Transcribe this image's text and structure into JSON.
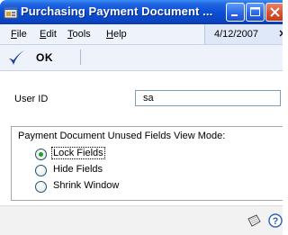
{
  "window": {
    "title": "Purchasing Payment Document ..."
  },
  "menu": {
    "items": [
      {
        "label": "File",
        "accel": "F",
        "rest": "ile"
      },
      {
        "label": "Edit",
        "accel": "E",
        "rest": "dit"
      },
      {
        "label": "Tools",
        "accel": "T",
        "rest": "ools"
      },
      {
        "label": "Help",
        "accel": "H",
        "rest": "elp"
      }
    ],
    "date": "4/12/2007"
  },
  "toolbar": {
    "ok_label": "OK"
  },
  "form": {
    "user_id_label": "User ID",
    "user_id_value": "sa",
    "group_title": "Payment Document Unused Fields View Mode:",
    "options": [
      {
        "label": "Lock Fields",
        "selected": true
      },
      {
        "label": "Hide Fields",
        "selected": false
      },
      {
        "label": "Shrink Window",
        "selected": false
      }
    ]
  },
  "colors": {
    "title_bar": "#0a4fd6",
    "close_button": "#d5502c",
    "radio_selected": "#20a020"
  },
  "icons": [
    "window-app-icon",
    "minimize-icon",
    "maximize-icon",
    "close-icon",
    "ok-checkmark-icon",
    "note-icon",
    "help-icon"
  ]
}
